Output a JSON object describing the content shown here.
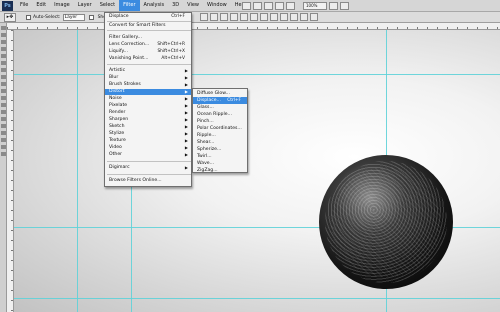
{
  "app": {
    "logo": "Ps"
  },
  "menubar": {
    "items": [
      "File",
      "Edit",
      "Image",
      "Layer",
      "Select",
      "Filter",
      "Analysis",
      "3D",
      "View",
      "Window",
      "Help"
    ],
    "active_index": 5,
    "zoom": "100%"
  },
  "options": {
    "auto_select_label": "Auto-Select:",
    "auto_select_value": "Layer",
    "show_label": "Show"
  },
  "filter_menu": {
    "items": [
      {
        "label": "Displace",
        "shortcut": "Ctrl+F"
      },
      {
        "label": "Convert for Smart Filters"
      },
      {
        "label": "Filter Gallery..."
      },
      {
        "label": "Lens Correction...",
        "shortcut": "Shift+Ctrl+R"
      },
      {
        "label": "Liquify...",
        "shortcut": "Shift+Ctrl+X"
      },
      {
        "label": "Vanishing Point...",
        "shortcut": "Alt+Ctrl+V"
      },
      {
        "label": "Artistic",
        "submenu": true
      },
      {
        "label": "Blur",
        "submenu": true
      },
      {
        "label": "Brush Strokes",
        "submenu": true
      },
      {
        "label": "Distort",
        "submenu": true,
        "highlighted": true
      },
      {
        "label": "Noise",
        "submenu": true
      },
      {
        "label": "Pixelate",
        "submenu": true
      },
      {
        "label": "Render",
        "submenu": true
      },
      {
        "label": "Sharpen",
        "submenu": true
      },
      {
        "label": "Sketch",
        "submenu": true
      },
      {
        "label": "Stylize",
        "submenu": true
      },
      {
        "label": "Texture",
        "submenu": true
      },
      {
        "label": "Video",
        "submenu": true
      },
      {
        "label": "Other",
        "submenu": true
      },
      {
        "label": "Digimarc",
        "submenu": true
      },
      {
        "label": "Browse Filters Online..."
      }
    ]
  },
  "distort_submenu": {
    "items": [
      {
        "label": "Diffuse Glow..."
      },
      {
        "label": "Displace...",
        "shortcut": "Ctrl+F",
        "highlighted": true
      },
      {
        "label": "Glass..."
      },
      {
        "label": "Ocean Ripple..."
      },
      {
        "label": "Pinch..."
      },
      {
        "label": "Polar Coordinates..."
      },
      {
        "label": "Ripple..."
      },
      {
        "label": "Shear..."
      },
      {
        "label": "Spherize..."
      },
      {
        "label": "Twirl..."
      },
      {
        "label": "Wave..."
      },
      {
        "label": "ZigZag..."
      }
    ]
  },
  "colors": {
    "highlight": "#3b8be0",
    "guide": "#5fd2d8"
  }
}
